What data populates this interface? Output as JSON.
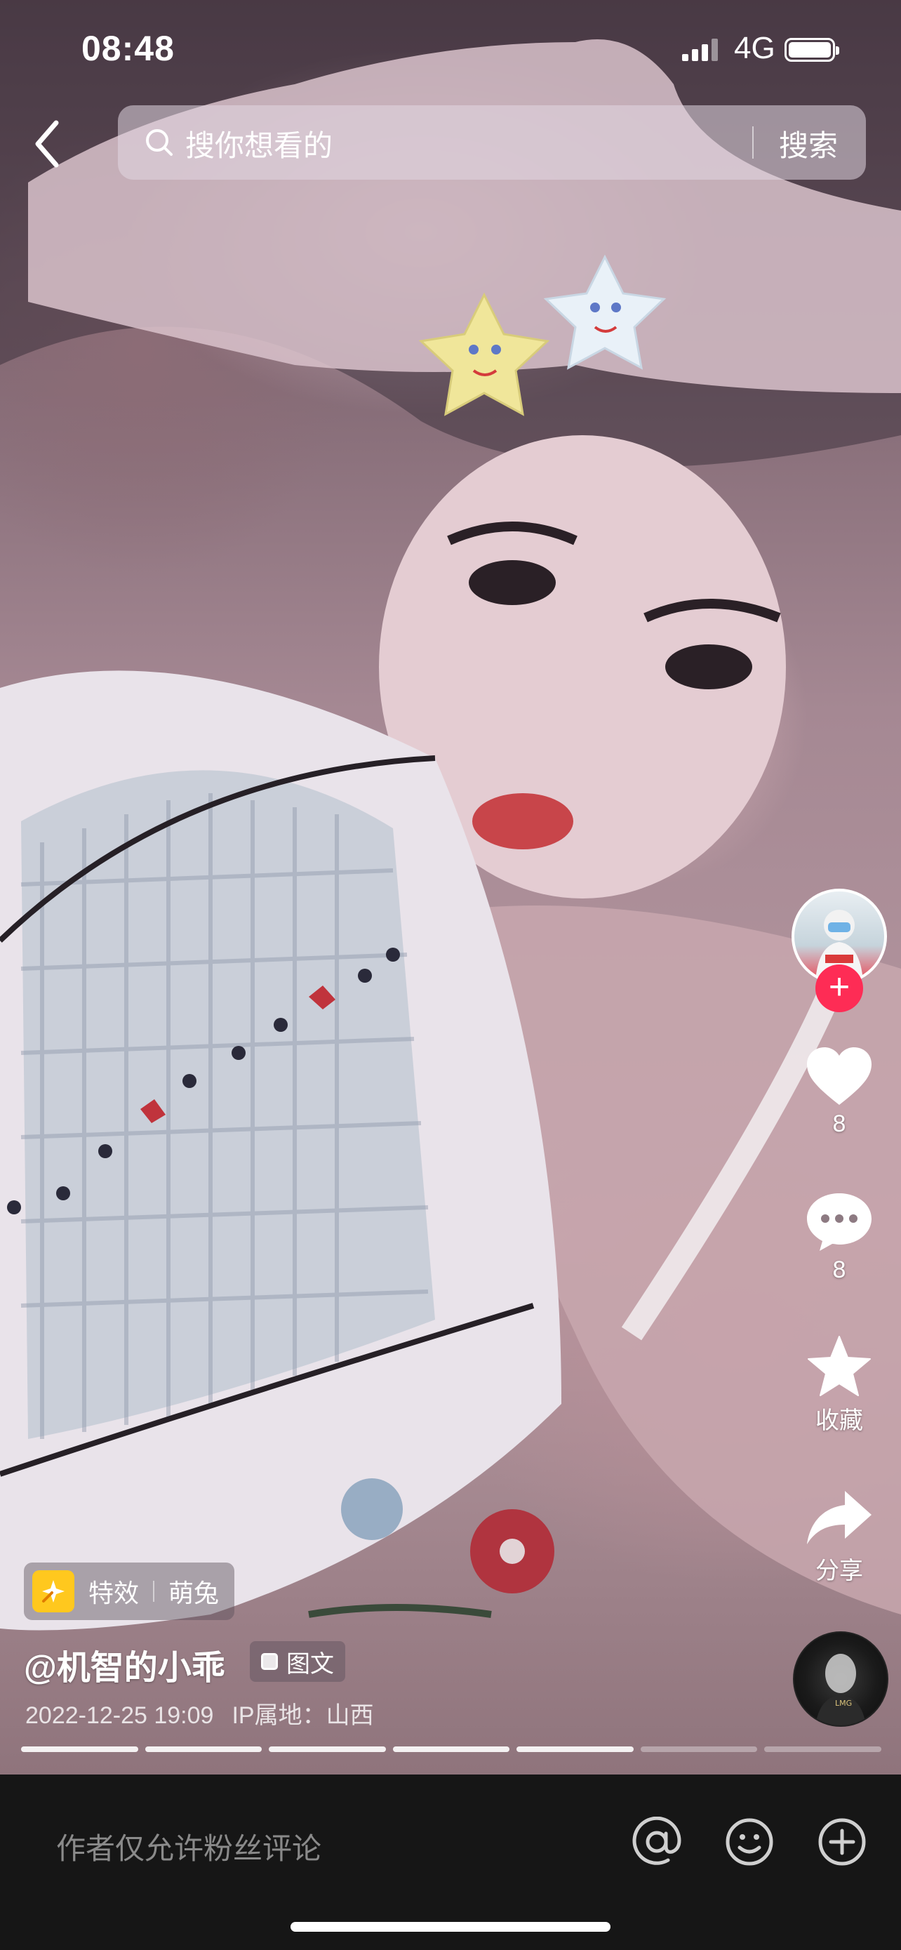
{
  "status_bar": {
    "time": "08:48",
    "network": "4G"
  },
  "search": {
    "placeholder": "搜你想看的",
    "button": "搜索"
  },
  "sidebar": {
    "likes": "8",
    "comments": "8",
    "favorite_label": "收藏",
    "share_label": "分享"
  },
  "post": {
    "effect_label": "特效",
    "effect_name": "萌兔",
    "author": "@机智的小乖",
    "type_badge": "图文",
    "datetime": "2022-12-25 19:09",
    "ip_location": "IP属地：山西",
    "image_progress": {
      "current": 5,
      "total": 7
    }
  },
  "comment_bar": {
    "placeholder": "作者仅允许粉丝评论"
  },
  "colors": {
    "follow_red": "#fe2c55",
    "effect_yellow": "#ffc81e",
    "comment_bg": "#161616"
  }
}
